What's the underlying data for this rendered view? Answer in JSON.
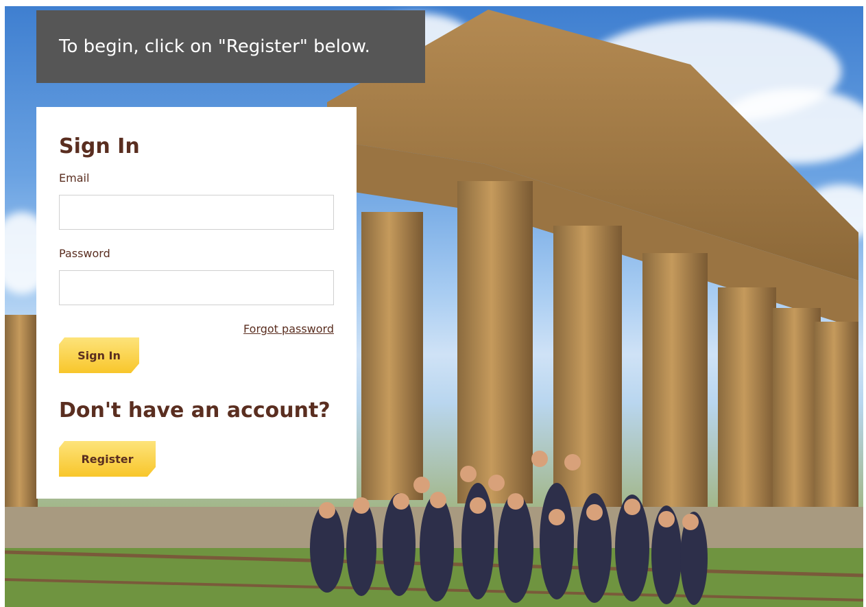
{
  "banner": {
    "text": "To begin, click on \"Register\" below."
  },
  "signin": {
    "title": "Sign In",
    "email_label": "Email",
    "email_value": "",
    "password_label": "Password",
    "password_value": "",
    "forgot_label": "Forgot password",
    "submit_label": "Sign In"
  },
  "register": {
    "prompt": "Don't have an account?",
    "button_label": "Register"
  },
  "colors": {
    "brand_brown": "#5a2e20",
    "button_yellow": "#f8c62b",
    "banner_gray": "#565656"
  }
}
